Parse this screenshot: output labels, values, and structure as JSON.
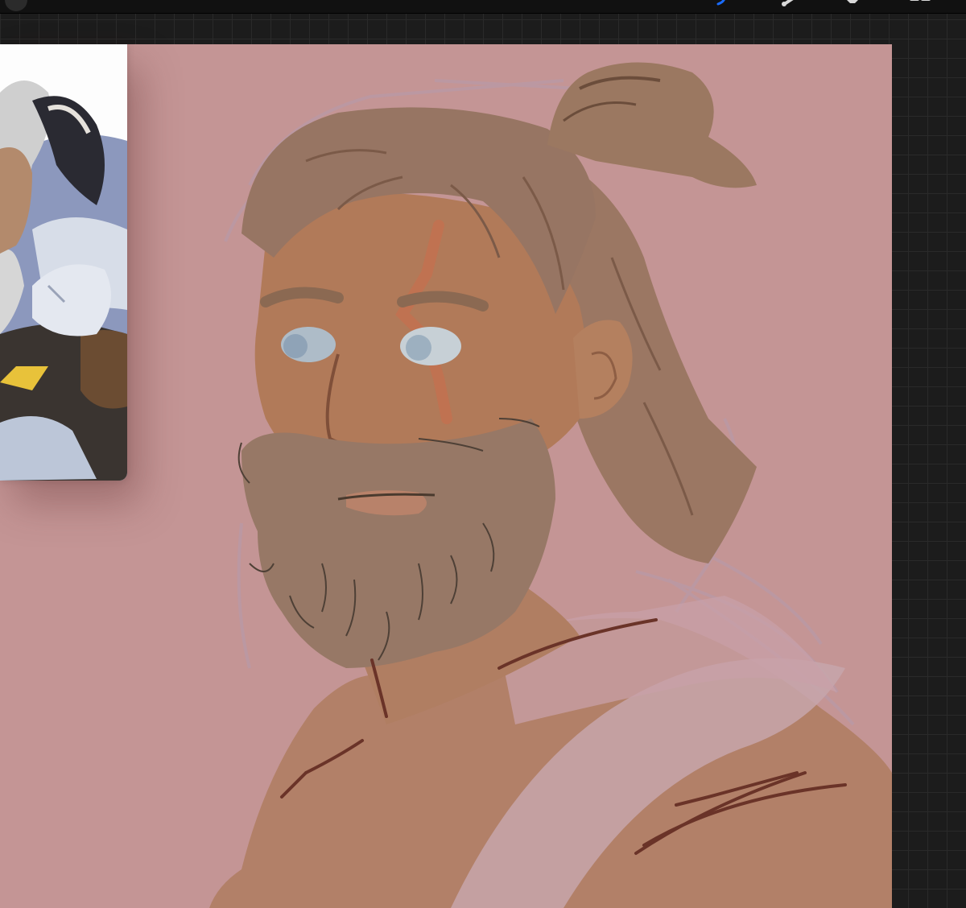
{
  "app": {
    "toolbar": {
      "tools": [
        "brush-icon",
        "smudge-icon",
        "eraser-icon",
        "layers-icon"
      ],
      "active_tool": "brush-icon",
      "accent_color": "#1a6cff"
    },
    "canvas": {
      "background_color": "#c49595"
    },
    "reference_window": {
      "visible": true
    },
    "workspace": {
      "background_color": "#1c1c1c"
    }
  }
}
